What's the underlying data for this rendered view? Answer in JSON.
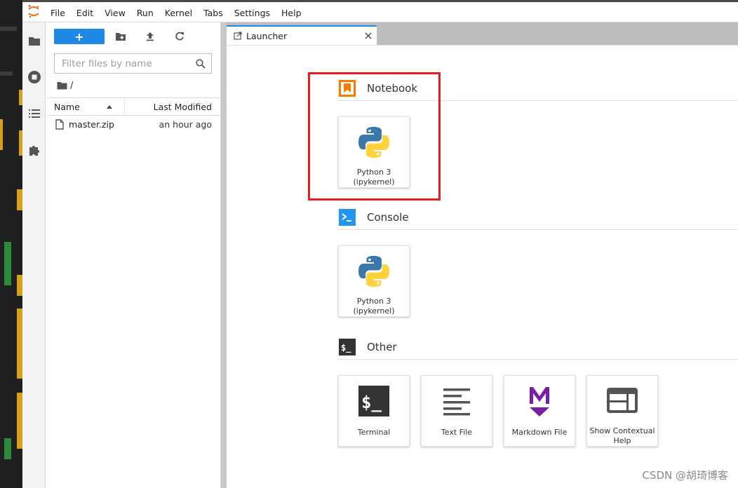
{
  "menubar": {
    "items": [
      "File",
      "Edit",
      "View",
      "Run",
      "Kernel",
      "Tabs",
      "Settings",
      "Help"
    ]
  },
  "sidebar": {
    "icons": [
      "folder-icon",
      "running-icon",
      "toc-icon",
      "extension-icon"
    ]
  },
  "filebrowser": {
    "new_label": "+",
    "filter_placeholder": "Filter files by name",
    "breadcrumb": "/",
    "columns": {
      "name": "Name",
      "modified": "Last Modified"
    },
    "files": [
      {
        "name": "master.zip",
        "modified": "an hour ago"
      }
    ]
  },
  "tabs": [
    {
      "label": "Launcher"
    }
  ],
  "launcher": {
    "sections": [
      {
        "title": "Notebook",
        "cards": [
          {
            "label": "Python 3 (ipykernel)"
          }
        ]
      },
      {
        "title": "Console",
        "cards": [
          {
            "label": "Python 3 (ipykernel)"
          }
        ]
      },
      {
        "title": "Other",
        "cards": [
          {
            "label": "Terminal"
          },
          {
            "label": "Text File"
          },
          {
            "label": "Markdown File"
          },
          {
            "label": "Show Contextual Help"
          }
        ]
      }
    ]
  },
  "colors": {
    "accent": "#1e88e5",
    "notebook_orange": "#f57c00",
    "console_blue": "#2196f3",
    "markdown_purple": "#7b1fa2",
    "highlight_red": "#e02020"
  },
  "watermark": "CSDN @胡琦博客"
}
